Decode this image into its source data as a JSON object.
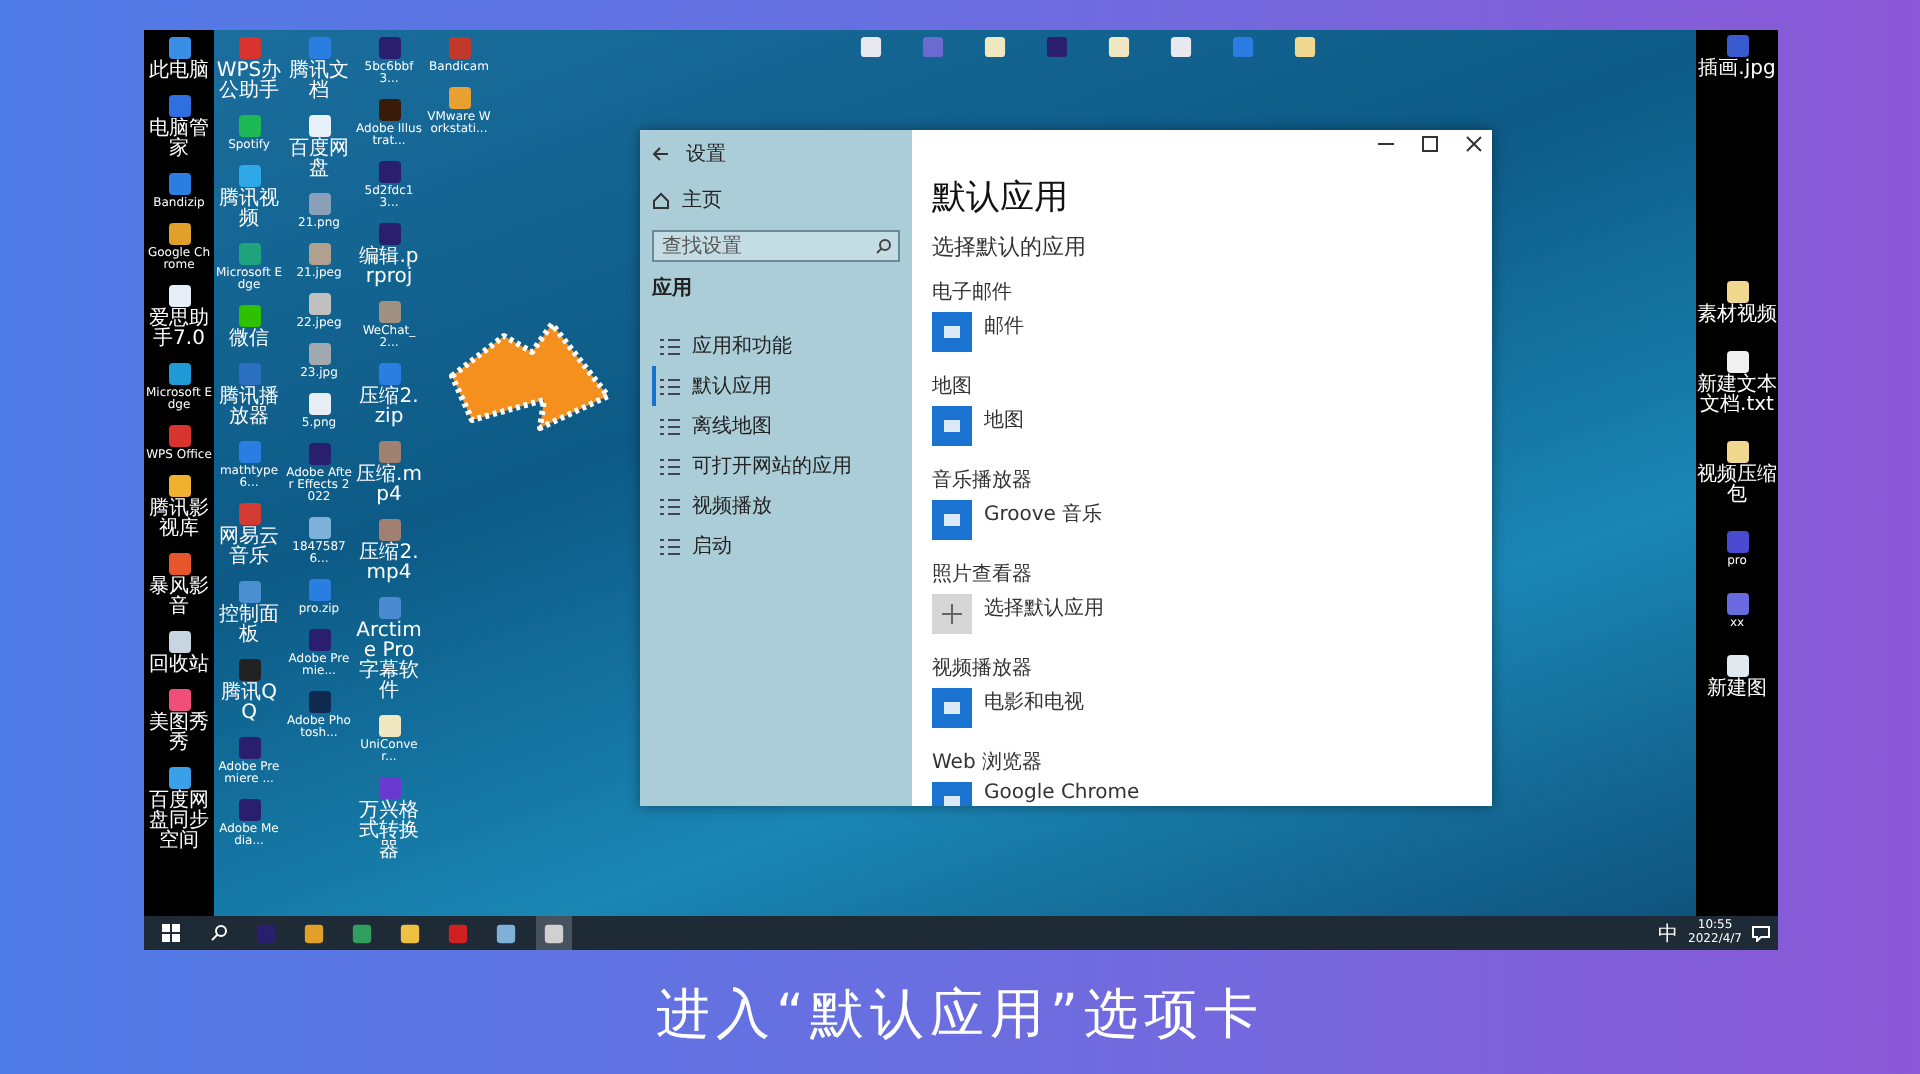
{
  "desktop": {
    "columns": [
      [
        {
          "label": "此电脑",
          "color": "#3a8ee6"
        },
        {
          "label": "电脑管家",
          "color": "#2f6fe0"
        },
        {
          "label": "Bandizip",
          "color": "#2a7de1"
        },
        {
          "label": "Google Chrome",
          "color": "#e0a02a"
        },
        {
          "label": "爱思助手7.0",
          "color": "#e8eef8"
        },
        {
          "label": "Microsoft Edge",
          "color": "#1e9bd7"
        },
        {
          "label": "WPS Office",
          "color": "#d8332c"
        },
        {
          "label": "腾讯影视库",
          "color": "#f0b030"
        },
        {
          "label": "暴风影音",
          "color": "#e8552a"
        },
        {
          "label": "回收站",
          "color": "#c8d4e0"
        },
        {
          "label": "美图秀秀",
          "color": "#ef4f7a"
        },
        {
          "label": "百度网盘同步空间",
          "color": "#3aa0e8"
        }
      ],
      [
        {
          "label": "WPS办公助手",
          "color": "#d8332c"
        },
        {
          "label": "Spotify",
          "color": "#1db954"
        },
        {
          "label": "腾讯视频",
          "color": "#2fa8e8"
        },
        {
          "label": "Microsoft Edge",
          "color": "#1fa37c"
        },
        {
          "label": "微信",
          "color": "#2dc100"
        },
        {
          "label": "腾讯播放器",
          "color": "#2a6fc0"
        },
        {
          "label": "mathtype6...",
          "color": "#2a7de1"
        },
        {
          "label": "网易云音乐",
          "color": "#d33a31"
        },
        {
          "label": "控制面板",
          "color": "#4a90d0"
        },
        {
          "label": "腾讯QQ",
          "color": "#222222"
        },
        {
          "label": "Adobe Premiere ...",
          "color": "#2a1f6e"
        },
        {
          "label": "Adobe Media...",
          "color": "#2a1f6e"
        }
      ],
      [
        {
          "label": "腾讯文档",
          "color": "#2a7de1"
        },
        {
          "label": "百度网盘",
          "color": "#e8f0fa"
        },
        {
          "label": "21.png",
          "color": "#8aa0b8"
        },
        {
          "label": "21.jpeg",
          "color": "#b0a090"
        },
        {
          "label": "22.jpeg",
          "color": "#c0c0c0"
        },
        {
          "label": "23.jpg",
          "color": "#a0a8b0"
        },
        {
          "label": "5.png",
          "color": "#e8eef4"
        },
        {
          "label": "Adobe After Effects 2022",
          "color": "#2a1f6e"
        },
        {
          "label": "18475876...",
          "color": "#7fb0d8"
        },
        {
          "label": "pro.zip",
          "color": "#2a7de1"
        },
        {
          "label": "Adobe Premie...",
          "color": "#2a1f6e"
        },
        {
          "label": "Adobe Photosh...",
          "color": "#0f2a4e"
        }
      ],
      [
        {
          "label": "5bc6bbf3...",
          "color": "#2a1f6e"
        },
        {
          "label": "Adobe Illustrat...",
          "color": "#3a1a0a"
        },
        {
          "label": "5d2fdc13...",
          "color": "#2a1f6e"
        },
        {
          "label": "编辑.prproj",
          "color": "#2a1f6e"
        },
        {
          "label": "WeChat_2...",
          "color": "#a09080"
        },
        {
          "label": "压缩2.zip",
          "color": "#2a7de1"
        },
        {
          "label": "压缩.mp4",
          "color": "#a08070"
        },
        {
          "label": "压缩2.mp4",
          "color": "#a08070"
        },
        {
          "label": "Arctime Pro 字幕软件",
          "color": "#4a8ad0"
        },
        {
          "label": "UniConver...",
          "color": "#f0e8c0"
        },
        {
          "label": "万兴格式转换器",
          "color": "#6a3ad0"
        }
      ],
      [
        {
          "label": "Bandicam",
          "color": "#c0392b"
        },
        {
          "label": "VMware Workstati...",
          "color": "#e8a030"
        }
      ]
    ]
  },
  "top_icons": [
    {
      "color": "#e8e8f0"
    },
    {
      "color": "#6a6ad0"
    },
    {
      "color": "#f0e8c0"
    },
    {
      "color": "#2a1f6e"
    },
    {
      "color": "#f0e8c0"
    },
    {
      "color": "#e8e8f0"
    },
    {
      "color": "#2a7de1"
    },
    {
      "color": "#f0d890"
    }
  ],
  "right_icons": [
    {
      "label": "插画.jpg",
      "color": "#3a5ad0"
    },
    {
      "label": "素材视频",
      "color": "#f0d890"
    },
    {
      "label": "新建文本文档.txt",
      "color": "#f0f0f0"
    },
    {
      "label": "视频压缩包",
      "color": "#f0d890"
    },
    {
      "label": "pro",
      "color": "#4a4ad0"
    },
    {
      "label": "xx",
      "color": "#6a6ae0"
    },
    {
      "label": "新建图",
      "color": "#e0e8f0"
    }
  ],
  "settings_window": {
    "title": "设置",
    "home": "主页",
    "search": {
      "placeholder": "查找设置"
    },
    "section": "应用",
    "nav": [
      {
        "label": "应用和功能",
        "selected": false
      },
      {
        "label": "默认应用",
        "selected": true
      },
      {
        "label": "离线地图",
        "selected": false
      },
      {
        "label": "可打开网站的应用",
        "selected": false
      },
      {
        "label": "视频播放",
        "selected": false
      },
      {
        "label": "启动",
        "selected": false
      }
    ],
    "heading": "默认应用",
    "subheading": "选择默认的应用",
    "groups": [
      {
        "label": "电子邮件",
        "app": "邮件",
        "kind": "app"
      },
      {
        "label": "地图",
        "app": "地图",
        "kind": "app"
      },
      {
        "label": "音乐播放器",
        "app": "Groove 音乐",
        "kind": "app"
      },
      {
        "label": "照片查看器",
        "app": "选择默认应用",
        "kind": "choose"
      },
      {
        "label": "视频播放器",
        "app": "电影和电视",
        "kind": "app"
      },
      {
        "label": "Web 浏览器",
        "app": "Google Chrome",
        "kind": "app"
      }
    ]
  },
  "taskbar": {
    "apps": [
      {
        "color": "#2a1f6e",
        "selected": false
      },
      {
        "color": "#e0a02a",
        "selected": false
      },
      {
        "color": "#2fa060",
        "selected": false
      },
      {
        "color": "#f0c040",
        "selected": false
      },
      {
        "color": "#d02020",
        "selected": false
      },
      {
        "color": "#7fb0d8",
        "selected": false
      },
      {
        "color": "#d0d0d0",
        "selected": true
      }
    ],
    "ime": "中",
    "time": "10:55",
    "date": "2022/4/7"
  },
  "caption": "进入“默认应用”选项卡"
}
